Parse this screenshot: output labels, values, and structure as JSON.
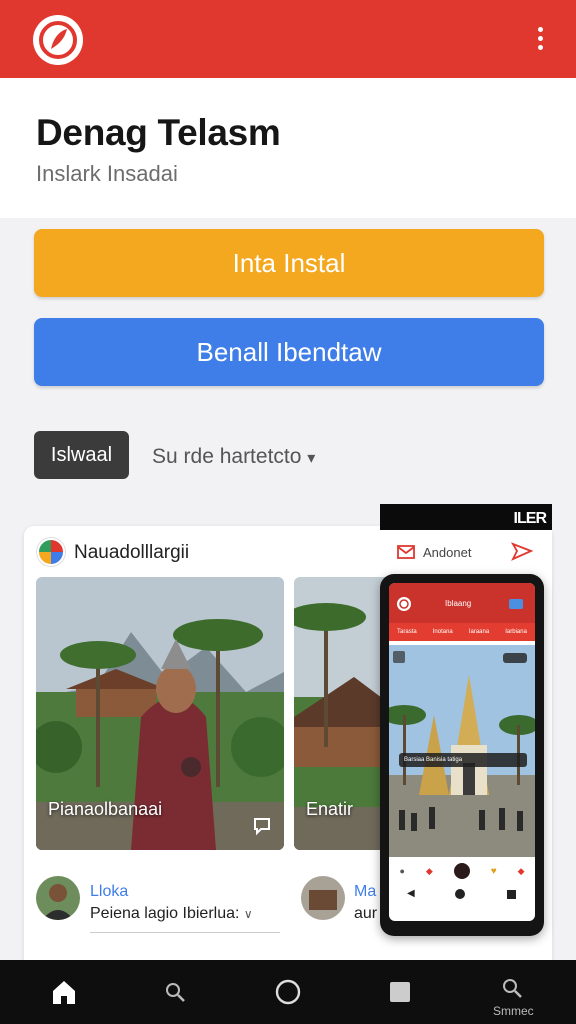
{
  "colors": {
    "brand_red": "#e0382f",
    "install_yellow": "#f3a81f",
    "secondary_blue": "#3f7ee8",
    "dark_chip": "#3b3b3b",
    "nav_black": "#0e0e0e"
  },
  "header": {
    "logo_icon": "app-logo-icon",
    "menu_icon": "kebab-menu-icon"
  },
  "hero": {
    "title": "Denag Telasm",
    "subtitle": "Inslark Insadai"
  },
  "buttons": {
    "install_label": "Inta Instal",
    "secondary_label": "Benall Ibendtaw"
  },
  "filters": {
    "chip_label": "Islwaal",
    "dropdown_label": "Su rde hartetcto",
    "dropdown_icon": "chevron-down-icon"
  },
  "card": {
    "author": "Nauadolllargii",
    "photos": [
      {
        "caption": "Pianaolbanaai"
      },
      {
        "caption": "Enatir"
      }
    ],
    "comments": [
      {
        "name": "Lloka",
        "text": "Peiena lagio Ibierlua:",
        "chevron": "chevron-down-icon"
      },
      {
        "name": "Ma",
        "text": "aur"
      }
    ]
  },
  "overlay": {
    "badge_text": "ILER",
    "share_label": "Andonet",
    "mail_icon": "mail-icon",
    "send_icon": "send-icon"
  },
  "phone_screen": {
    "title": "Iblaang",
    "tabs": [
      "Tarasta",
      "Inotana",
      "Iaraana",
      "Iarbiana"
    ],
    "caption": "Barsiaa Banisia tatiga"
  },
  "bottom_nav": {
    "items": [
      "home-icon",
      "search-icon",
      "circle-icon",
      "square-icon",
      "search-icon"
    ],
    "last_label": "Smmec"
  }
}
